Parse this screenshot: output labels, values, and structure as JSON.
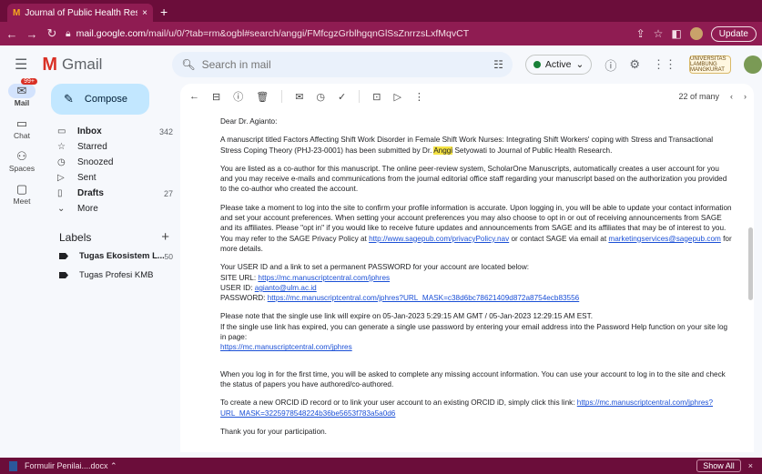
{
  "browser": {
    "tab_title": "Journal of Public Health Resea",
    "tab_close": "×",
    "new_tab": "+",
    "url_host": "mail.google.com",
    "url_path": "/mail/u/0/?tab=rm&ogbl#search/anggi/FMfcgzGrblhgqnGlSsZnrrzsLxfMqvCT",
    "update_label": "Update"
  },
  "header": {
    "app_name": "Gmail",
    "search_placeholder": "Search in mail",
    "status_label": "Active",
    "university_badge": "UNIVERSITAS LAMBUNG MANGKURAT"
  },
  "rail": {
    "mail_label": "Mail",
    "mail_badge": "99+",
    "chat_label": "Chat",
    "spaces_label": "Spaces",
    "meet_label": "Meet"
  },
  "sidebar": {
    "compose_label": "Compose",
    "items": [
      {
        "label": "Inbox",
        "count": "342",
        "icon": "inbox-icon"
      },
      {
        "label": "Starred",
        "count": "",
        "icon": "star-icon"
      },
      {
        "label": "Snoozed",
        "count": "",
        "icon": "clock-icon"
      },
      {
        "label": "Sent",
        "count": "",
        "icon": "send-icon"
      },
      {
        "label": "Drafts",
        "count": "27",
        "icon": "draft-icon"
      },
      {
        "label": "More",
        "count": "",
        "icon": "chevron-down-icon"
      }
    ],
    "labels_title": "Labels",
    "labels": [
      {
        "label": "Tugas Ekosistem L...",
        "count": "50"
      },
      {
        "label": "Tugas Profesi KMB",
        "count": ""
      }
    ]
  },
  "toolbar": {
    "pager_text": "22 of many"
  },
  "email": {
    "greeting": "Dear Dr. Agianto:",
    "p1_before": "A manuscript titled Factors Affecting Shift Work Disorder in Female Shift Work Nurses: Integrating Shift Workers' coping with Stress and Transactional Stress Coping Theory (PHJ-23-0001) has been submitted by Dr. ",
    "p1_highlight": "Anggi",
    "p1_after": " Setyowati to Journal of Public Health Research.",
    "p2": "You are listed as a co-author for this manuscript. The online peer-review system, ScholarOne Manuscripts, automatically creates a user account for you and you may receive e-mails and communications from the journal editorial office staff regarding your manuscript based on the authorization you provided to the co-author who created the account.",
    "p3_before": "Please take a moment to log into the site to confirm your profile information is accurate.  Upon logging in, you will be able to update your contact information and set your account preferences. When setting your account preferences you may also choose to opt in or out of receiving announcements from SAGE and its affiliates. Please \"opt in\" if you would like to receive future updates and announcements from SAGE and its affiliates that may be of interest to you. You may refer to the SAGE Privacy Policy at ",
    "p3_link1": "http://www.sagepub.com/privacyPolicy.nav",
    "p3_mid": " or contact SAGE via email at ",
    "p3_link2": "marketingservices@sagepub.com",
    "p3_after": " for more details.",
    "p4_intro": "Your USER ID and a link to set a permanent PASSWORD for your account are located below:",
    "site_label": "SITE URL: ",
    "site_url": "https://mc.manuscriptcentral.com/jphres",
    "user_label": "USER ID: ",
    "user_id": "agianto@ulm.ac.id",
    "pass_label": "PASSWORD: ",
    "pass_url": "https://mc.manuscriptcentral.com/jphres?URL_MASK=c38d6bc78621409d872a8754ecb83556",
    "p5_line1": "Please note that the single use link will expire on 05-Jan-2023 5:29:15 AM GMT / 05-Jan-2023 12:29:15 AM EST.",
    "p5_line2": "If the single use link has expired, you can generate a single use password by entering your email address into the Password Help function on your site log in page:",
    "p5_link": "https://mc.manuscriptcentral.com/jphres",
    "p6": "When you log in for the first time, you will be asked to complete any missing account information. You can use your account to log in to the site and check the status of papers you have authored/co-authored.",
    "p7_before": "To create a new ORCID iD record or to link your user account to an existing ORCID iD, simply click this link: ",
    "p7_link": "https://mc.manuscriptcentral.com/jphres?URL_MASK=3225978548224b36be5653f783a5a0d6",
    "p8": "Thank you for your participation."
  },
  "downloads": {
    "file_name": "Formulir Penilai....docx",
    "show_all": "Show All"
  }
}
